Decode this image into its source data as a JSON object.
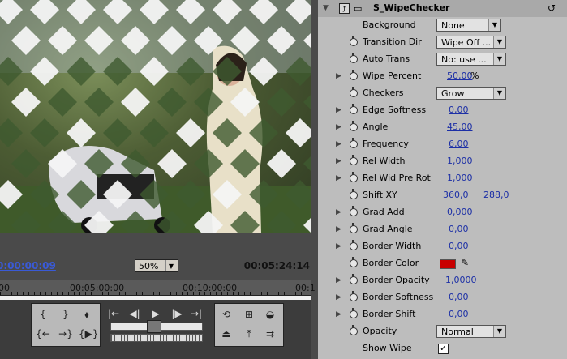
{
  "monitor": {
    "current_time": "0:00:00:09",
    "duration": "00:05:24:14",
    "zoom": "50%",
    "ruler_labels": [
      "00",
      "00:05:00:00",
      "00:10:00:00",
      "00:1"
    ]
  },
  "transport": {
    "icons": [
      "mark-in-icon",
      "mark-out-icon",
      "set-marker-icon",
      "go-to-in-icon",
      "go-to-out-icon",
      "play-in-to-out-icon",
      "step-back-icon",
      "step-frame-back-icon",
      "play-icon",
      "step-frame-forward-icon",
      "step-forward-icon",
      "loop-icon",
      "safe-margins-icon",
      "output-icon",
      "lift-icon",
      "extract-icon",
      "trim-icon"
    ]
  },
  "effect": {
    "name": "S_WipeChecker",
    "rows": [
      {
        "label": "Background",
        "type": "dropdown",
        "value": "None",
        "tri": false,
        "stopwatch": false
      },
      {
        "label": "Transition Dir",
        "type": "dropdown",
        "value": "Wipe Off ...",
        "tri": false,
        "stopwatch": true
      },
      {
        "label": "Auto Trans",
        "type": "dropdown",
        "value": "No: use ...",
        "tri": false,
        "stopwatch": true
      },
      {
        "label": "Wipe Percent",
        "type": "value",
        "value": "50,00",
        "suffix": "%",
        "tri": true,
        "stopwatch": true
      },
      {
        "label": "Checkers",
        "type": "dropdown",
        "value": "Grow",
        "tri": false,
        "stopwatch": true
      },
      {
        "label": "Edge Softness",
        "type": "value",
        "value": "0,00",
        "tri": true,
        "stopwatch": true
      },
      {
        "label": "Angle",
        "type": "value",
        "value": "45,00",
        "tri": true,
        "stopwatch": true
      },
      {
        "label": "Frequency",
        "type": "value",
        "value": "6,00",
        "tri": true,
        "stopwatch": true
      },
      {
        "label": "Rel Width",
        "type": "value",
        "value": "1,000",
        "tri": true,
        "stopwatch": true
      },
      {
        "label": "Rel Wid Pre Rot",
        "type": "value",
        "value": "1,000",
        "tri": true,
        "stopwatch": true
      },
      {
        "label": "Shift XY",
        "type": "xy",
        "value": "360,0",
        "value2": "288,0",
        "tri": false,
        "stopwatch": true
      },
      {
        "label": "Grad Add",
        "type": "value",
        "value": "0,000",
        "tri": true,
        "stopwatch": true
      },
      {
        "label": "Grad Angle",
        "type": "value",
        "value": "0,00",
        "tri": true,
        "stopwatch": true
      },
      {
        "label": "Border Width",
        "type": "value",
        "value": "0,00",
        "tri": true,
        "stopwatch": true
      },
      {
        "label": "Border Color",
        "type": "color",
        "value": "#c80000",
        "tri": false,
        "stopwatch": true
      },
      {
        "label": "Border Opacity",
        "type": "value",
        "value": "1,0000",
        "tri": true,
        "stopwatch": true
      },
      {
        "label": "Border Softness",
        "type": "value",
        "value": "0,00",
        "tri": true,
        "stopwatch": true
      },
      {
        "label": "Border Shift",
        "type": "value",
        "value": "0,00",
        "tri": true,
        "stopwatch": true
      },
      {
        "label": "Opacity",
        "type": "dropdown",
        "value": "Normal",
        "tri": false,
        "stopwatch": true
      },
      {
        "label": "Show Wipe",
        "type": "checkbox",
        "value": "✓",
        "tri": false,
        "stopwatch": false
      }
    ]
  },
  "colors": {
    "accent": "#1c2fa6",
    "timecode": "#3a5ad6",
    "border_color": "#c80000"
  }
}
